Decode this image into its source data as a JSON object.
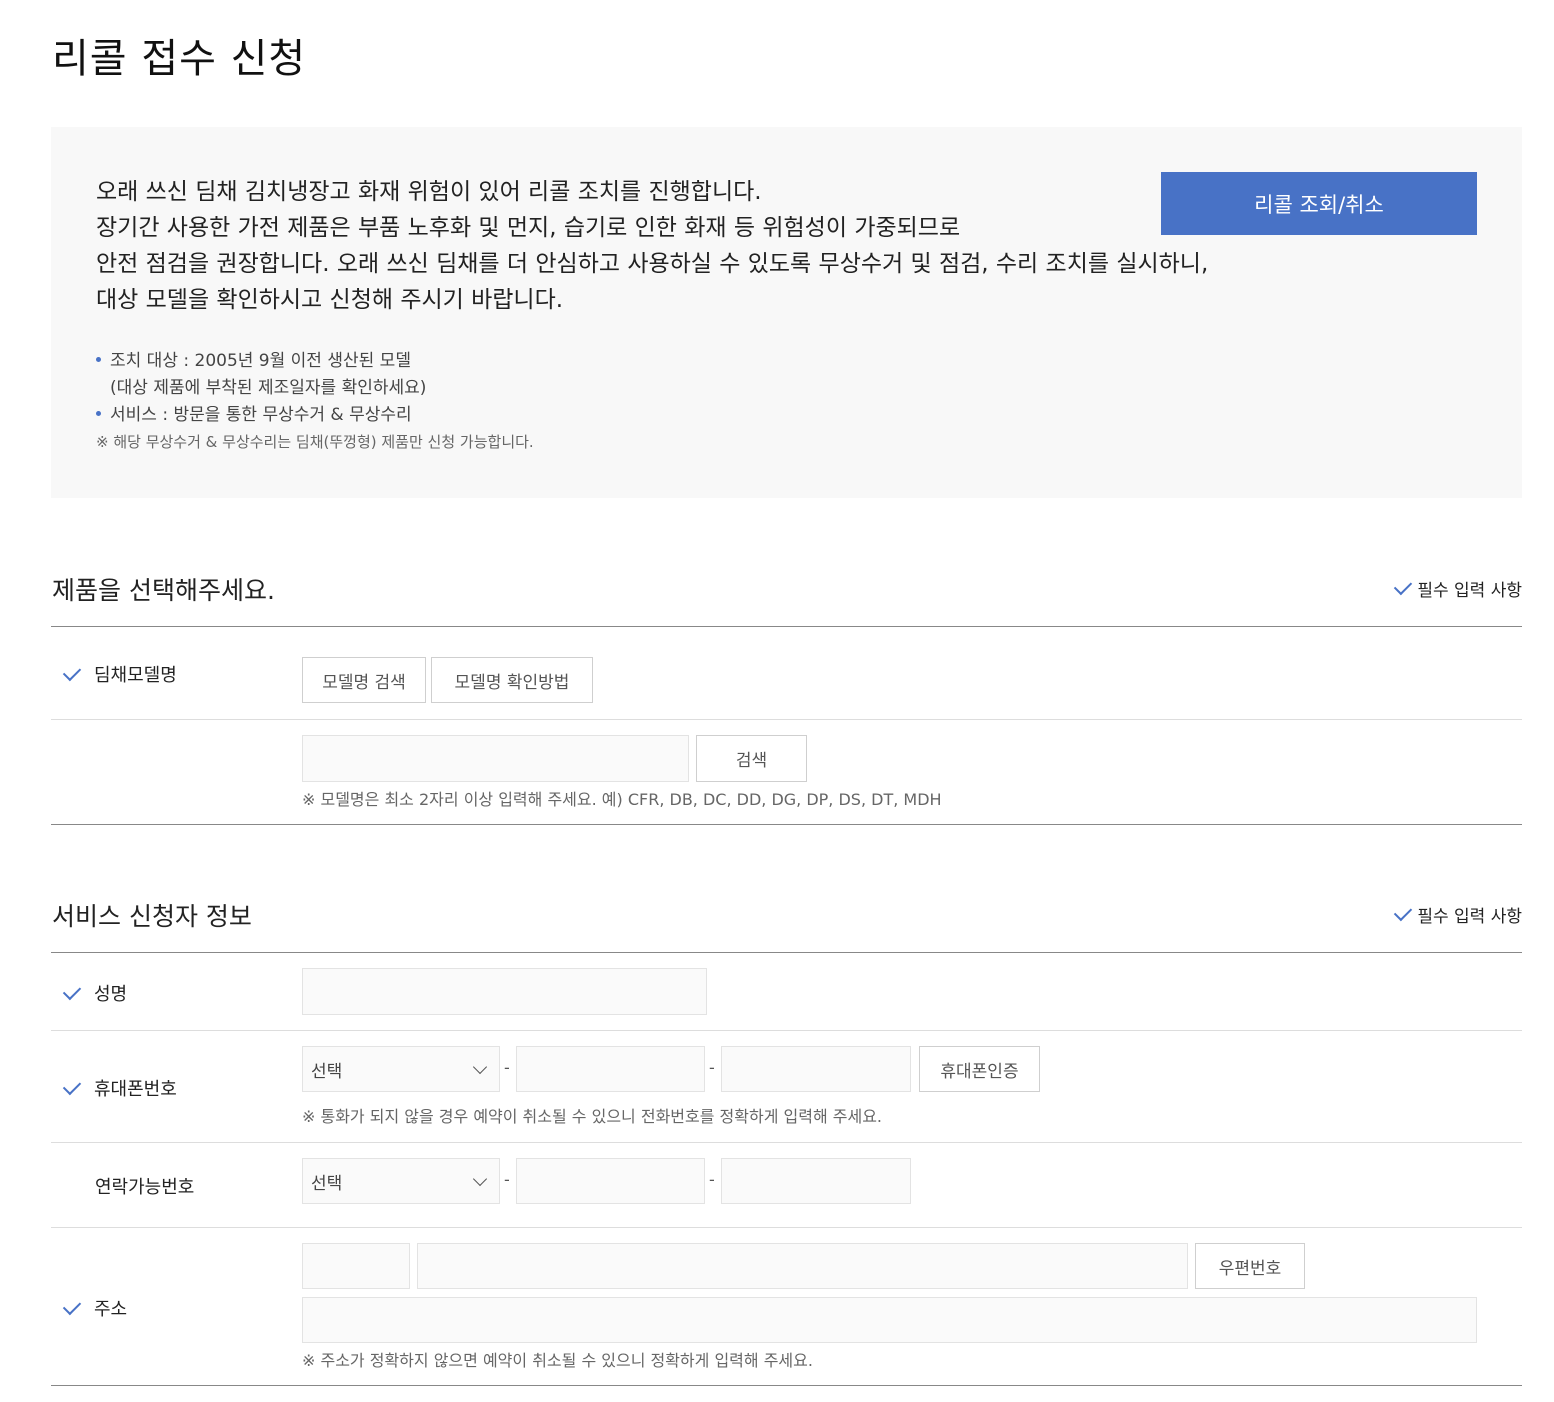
{
  "page": {
    "title": "리콜 접수 신청"
  },
  "notice": {
    "lines": [
      "오래 쓰신 딤채 김치냉장고 화재 위험이 있어 리콜 조치를 진행합니다.",
      "장기간 사용한 가전 제품은 부품 노후화 및 먼지, 습기로 인한 화재 등 위험성이 가중되므로",
      "안전 점검을 권장합니다. 오래 쓰신 딤채를 더 안심하고 사용하실 수 있도록 무상수거 및 점검, 수리 조치를 실시하니,",
      "대상 모델을 확인하시고 신청해 주시기 바랍니다."
    ],
    "recall_button": "리콜 조회/취소",
    "bullet1": "조치 대상 : 2005년 9월 이전 생산된 모델",
    "bullet1_sub": "(대상 제품에 부착된 제조일자를 확인하세요)",
    "bullet2": "서비스 : 방문을 통한 무상수거 & 무상수리",
    "footnote": "※ 해당 무상수거 & 무상수리는 딤채(뚜껑형) 제품만 신청 가능합니다."
  },
  "product_section": {
    "title": "제품을 선택해주세요.",
    "required_label": "필수 입력 사항",
    "model_label": "딤채모델명",
    "search_model_button": "모델명 검색",
    "how_to_button": "모델명 확인방법",
    "search_button": "검색",
    "search_value": "",
    "hint": "※ 모델명은 최소 2자리 이상 입력해 주세요. 예) CFR, DB, DC, DD, DG, DP, DS, DT, MDH"
  },
  "applicant_section": {
    "title": "서비스 신청자 정보",
    "required_label": "필수 입력 사항",
    "name_label": "성명",
    "mobile_label": "휴대폰번호",
    "mobile_select": "선택",
    "mobile_verify_button": "휴대폰인증",
    "mobile_hint": "※ 통화가 되지 않을 경우 예약이 취소될 수 있으니 전화번호를 정확하게 입력해 주세요.",
    "contact_label": "연락가능번호",
    "contact_select": "선택",
    "address_label": "주소",
    "zipcode_button": "우편번호",
    "address_hint": "※ 주소가 정확하지 않으면 예약이 취소될 수 있으니 정확하게 입력해 주세요.",
    "dash": "-"
  },
  "colors": {
    "accent": "#4872c6",
    "notice_bg": "#f8f8f8"
  }
}
